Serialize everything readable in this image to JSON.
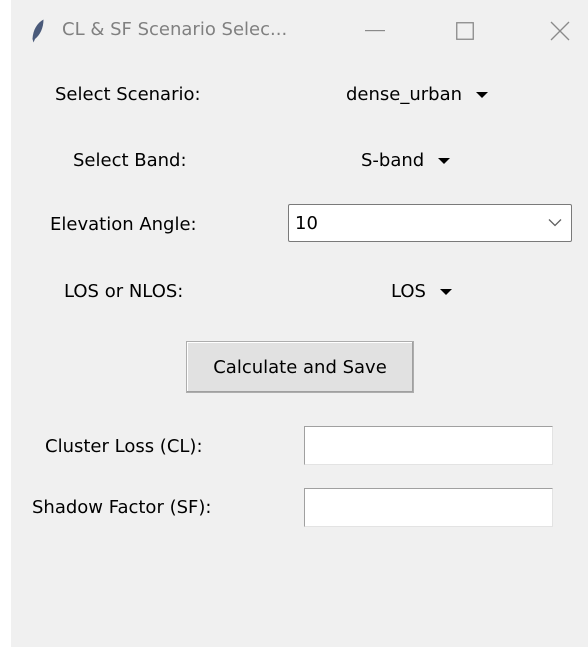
{
  "window": {
    "title": "CL & SF Scenario Selec...",
    "controls": {
      "minimize_icon": "minimize-icon",
      "maximize_icon": "maximize-icon",
      "close_icon": "close-icon"
    },
    "app_icon": "feather-icon"
  },
  "form": {
    "scenario": {
      "label": "Select Scenario:",
      "value": "dense_urban"
    },
    "band": {
      "label": "Select Band:",
      "value": "S-band"
    },
    "elevation": {
      "label": "Elevation Angle:",
      "value": "10"
    },
    "los": {
      "label": "LOS or NLOS:",
      "value": "LOS"
    },
    "calculate_button": "Calculate and Save",
    "cluster_loss": {
      "label": "Cluster Loss (CL):",
      "value": ""
    },
    "shadow_factor": {
      "label": "Shadow Factor (SF):",
      "value": ""
    }
  },
  "colors": {
    "window_bg": "#f0f0f0",
    "title_text": "#808080",
    "button_bg": "#e1e1e1"
  }
}
